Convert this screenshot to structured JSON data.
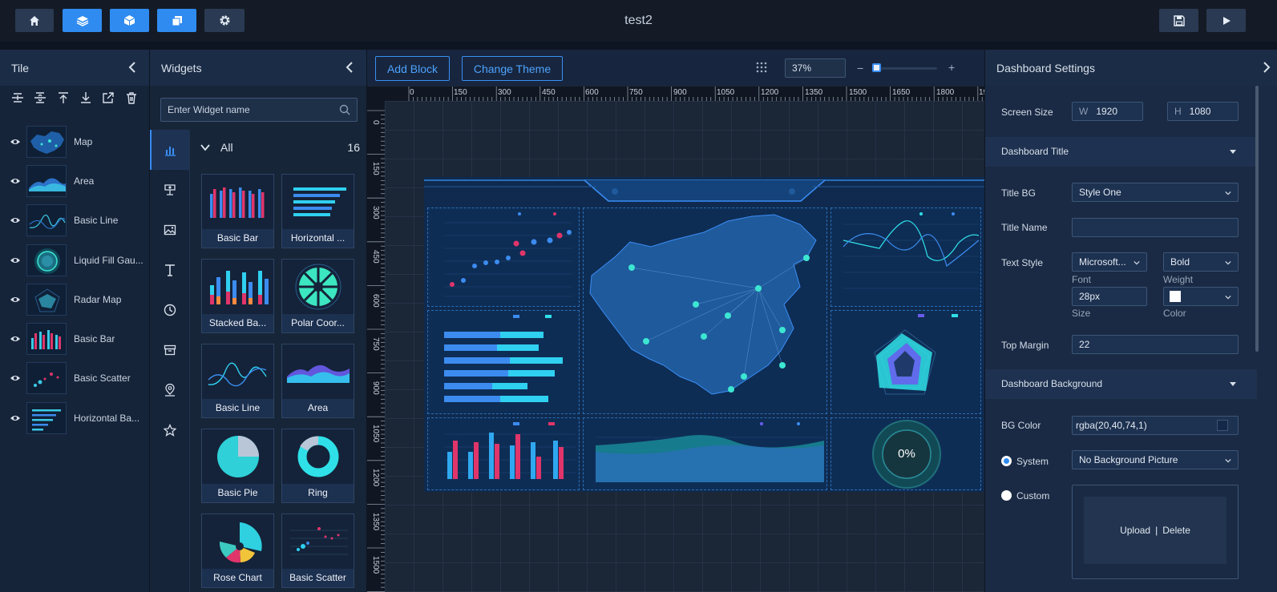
{
  "app": {
    "title": "test2"
  },
  "tile_panel": {
    "title": "Tile",
    "items": [
      {
        "label": "Map"
      },
      {
        "label": "Area"
      },
      {
        "label": "Basic Line"
      },
      {
        "label": "Liquid Fill Gau..."
      },
      {
        "label": "Radar Map"
      },
      {
        "label": "Basic Bar"
      },
      {
        "label": "Basic Scatter"
      },
      {
        "label": "Horizontal Ba..."
      }
    ]
  },
  "widgets_panel": {
    "title": "Widgets",
    "search_placeholder": "Enter Widget name",
    "all_label": "All",
    "all_count": "16",
    "cards": [
      {
        "label": "Basic Bar"
      },
      {
        "label": "Horizontal ..."
      },
      {
        "label": "Stacked Ba..."
      },
      {
        "label": "Polar Coor..."
      },
      {
        "label": "Basic Line"
      },
      {
        "label": "Area"
      },
      {
        "label": "Basic Pie"
      },
      {
        "label": "Ring"
      },
      {
        "label": "Rose Chart"
      },
      {
        "label": "Basic Scatter"
      }
    ]
  },
  "canvas": {
    "add_block": "Add Block",
    "change_theme": "Change Theme",
    "zoom": "37%",
    "zoom_minus": "−",
    "zoom_plus": "+",
    "ruler_x": [
      "0",
      "150",
      "300",
      "450",
      "600",
      "750",
      "900",
      "1050",
      "1200",
      "1350",
      "1500",
      "1650",
      "1800",
      "19"
    ],
    "ruler_y": [
      "0",
      "150",
      "300",
      "450",
      "600",
      "750",
      "900",
      "1050",
      "1200",
      "1350",
      "1500"
    ],
    "liquid_value": "0%"
  },
  "settings": {
    "title": "Dashboard Settings",
    "screen_size_label": "Screen Size",
    "w_prefix": "W",
    "width": "1920",
    "h_prefix": "H",
    "height": "1080",
    "title_section": "Dashboard Title",
    "title_bg_label": "Title BG",
    "title_bg_value": "Style One",
    "title_name_label": "Title Name",
    "title_name_value": "",
    "text_style_label": "Text Style",
    "font_value": "Microsoft...",
    "weight_value": "Bold",
    "font_caption": "Font",
    "weight_caption": "Weight",
    "size_value": "28px",
    "size_caption": "Size",
    "color_caption": "Color",
    "top_margin_label": "Top Margin",
    "top_margin_value": "22",
    "bg_section": "Dashboard Background",
    "bg_color_label": "BG Color",
    "bg_color_value": "rgba(20,40,74,1)",
    "system_label": "System",
    "system_value": "No Background Picture",
    "custom_label": "Custom",
    "upload": "Upload",
    "separator": "|",
    "delete": "Delete"
  },
  "colors": {
    "accent": "#2f8bf0",
    "panel": "#16243a",
    "cyan": "#22d3ee",
    "pink": "#e0356a"
  }
}
